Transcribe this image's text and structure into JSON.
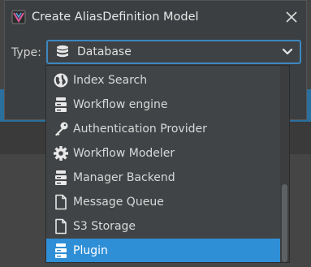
{
  "dialog": {
    "title": "Create AliasDefinition Model",
    "close_icon": "close-icon"
  },
  "form": {
    "type_label": "Type:",
    "selected_value": "Database",
    "selected_icon": "database-icon"
  },
  "dropdown": {
    "items": [
      {
        "label": "Index Search",
        "icon": "globe-icon"
      },
      {
        "label": "Workflow engine",
        "icon": "server-icon"
      },
      {
        "label": "Authentication Provider",
        "icon": "key-icon"
      },
      {
        "label": "Workflow Modeler",
        "icon": "gear-icon"
      },
      {
        "label": "Manager Backend",
        "icon": "server-icon"
      },
      {
        "label": "Message Queue",
        "icon": "file-icon"
      },
      {
        "label": "S3 Storage",
        "icon": "file-icon"
      },
      {
        "label": "Plugin",
        "icon": "server-icon",
        "selected": true
      }
    ]
  },
  "colors": {
    "accent": "#2f8fd6",
    "focus_border": "#3d87c0",
    "dialog_bg": "#3c3f41"
  }
}
